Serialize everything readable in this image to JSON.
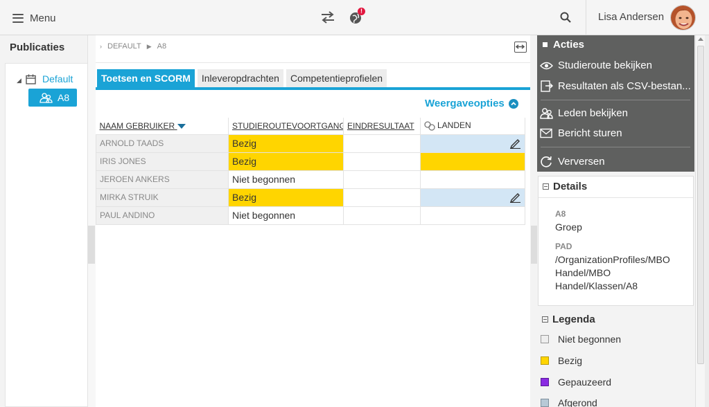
{
  "header": {
    "menu_label": "Menu",
    "notification_badge": "!",
    "user_name": "Lisa Andersen"
  },
  "left": {
    "title": "Publicaties",
    "tree": {
      "root_label": "Default",
      "selected_label": "A8"
    }
  },
  "breadcrumb": {
    "items": [
      "DEFAULT",
      "A8"
    ]
  },
  "tabs": [
    {
      "label": "Toetsen en SCORM",
      "active": true
    },
    {
      "label": "Inleveropdrachten",
      "active": false
    },
    {
      "label": "Competentieprofielen",
      "active": false
    }
  ],
  "view_options_label": "Weergaveopties",
  "table": {
    "columns": [
      "NAAM GEBRUIKER",
      "STUDIEROUTEVOORTGANG",
      "EINDRESULTAAT",
      "LANDEN"
    ],
    "rows": [
      {
        "name": "ARNOLD TAADS",
        "progress": "Bezig",
        "result": "",
        "landen": "editable"
      },
      {
        "name": "IRIS JONES",
        "progress": "Bezig",
        "result": "",
        "landen": "yellow"
      },
      {
        "name": "JEROEN ANKERS",
        "progress": "Niet begonnen",
        "result": "",
        "landen": ""
      },
      {
        "name": "MIRKA STRUIK",
        "progress": "Bezig",
        "result": "",
        "landen": "editable"
      },
      {
        "name": "PAUL ANDINO",
        "progress": "Niet begonnen",
        "result": "",
        "landen": ""
      }
    ]
  },
  "acties": {
    "title": "Acties",
    "items": [
      {
        "label": "Studieroute bekijken",
        "icon": "eye-icon"
      },
      {
        "label": "Resultaten als CSV-bestan...",
        "icon": "export-icon"
      },
      {
        "label": "Leden bekijken",
        "icon": "users-icon"
      },
      {
        "label": "Bericht sturen",
        "icon": "mail-icon"
      },
      {
        "label": "Verversen",
        "icon": "refresh-icon"
      }
    ]
  },
  "details": {
    "title": "Details",
    "name_label": "A8",
    "name_value": "Groep",
    "path_label": "PAD",
    "path_value": "/OrganizationProfiles/MBO Handel/MBO Handel/Klassen/A8"
  },
  "legenda": {
    "title": "Legenda",
    "items": [
      {
        "label": "Niet begonnen",
        "color": "#eeeeee"
      },
      {
        "label": "Bezig",
        "color": "#ffd500"
      },
      {
        "label": "Gepauzeerd",
        "color": "#8a2be2"
      },
      {
        "label": "Afgerond",
        "color": "#b7c9d6"
      }
    ]
  },
  "colors": {
    "accent": "#1aa3d6",
    "busy": "#ffd500",
    "panel_dark": "#5f605f"
  }
}
